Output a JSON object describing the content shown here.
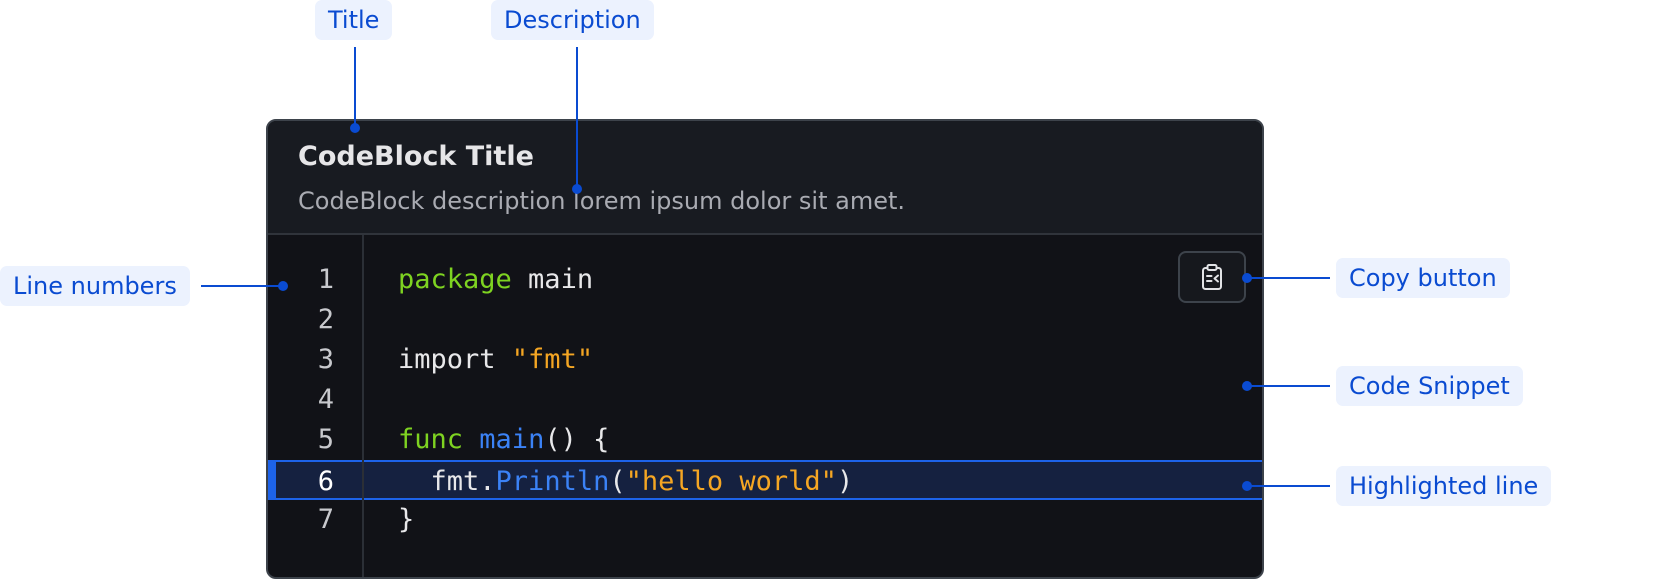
{
  "codeblock": {
    "title": "CodeBlock Title",
    "description": "CodeBlock description lorem ipsum dolor sit amet.",
    "copy_icon": "clipboard-icon",
    "lines": [
      {
        "number": "1",
        "tokens": [
          {
            "t": "package",
            "c": "kw"
          },
          {
            "t": " main",
            "c": ""
          }
        ]
      },
      {
        "number": "2",
        "tokens": []
      },
      {
        "number": "3",
        "tokens": [
          {
            "t": "import ",
            "c": ""
          },
          {
            "t": "\"fmt\"",
            "c": "str"
          }
        ]
      },
      {
        "number": "4",
        "tokens": []
      },
      {
        "number": "5",
        "tokens": [
          {
            "t": "func",
            "c": "kw"
          },
          {
            "t": " ",
            "c": ""
          },
          {
            "t": "main",
            "c": "fn"
          },
          {
            "t": "() {",
            "c": ""
          }
        ]
      },
      {
        "number": "6",
        "highlighted": true,
        "tokens": [
          {
            "t": "  fmt.",
            "c": ""
          },
          {
            "t": "Println",
            "c": "fn"
          },
          {
            "t": "(",
            "c": ""
          },
          {
            "t": "\"hello world\"",
            "c": "str"
          },
          {
            "t": ")",
            "c": ""
          }
        ]
      },
      {
        "number": "7",
        "tokens": [
          {
            "t": "}",
            "c": ""
          }
        ]
      }
    ]
  },
  "callouts": {
    "title": "Title",
    "description": "Description",
    "line_numbers": "Line numbers",
    "copy_button": "Copy button",
    "code_snippet": "Code Snippet",
    "highlighted_line": "Highlighted line"
  },
  "colors": {
    "callout_text": "#0a4bd1",
    "callout_bg": "#ecf2fe",
    "keyword": "#7ed321",
    "string": "#f5a623",
    "function": "#3b82f6",
    "highlight": "#1d63ea"
  }
}
